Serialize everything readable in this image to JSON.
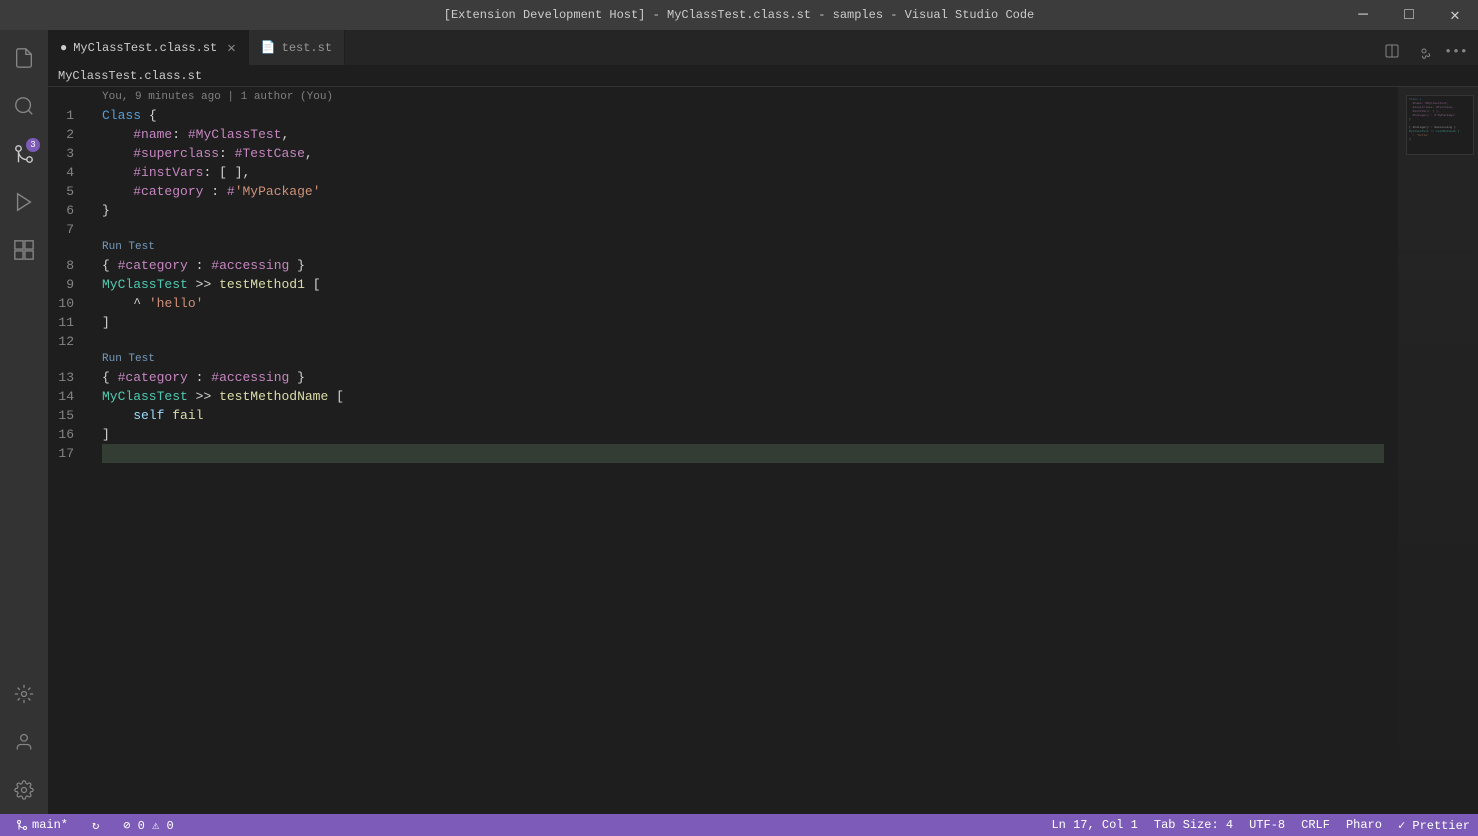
{
  "titlebar": {
    "title": "[Extension Development Host] - MyClassTest.class.st - samples - Visual Studio Code",
    "minimize": "─",
    "maximize": "□",
    "close": "✕"
  },
  "tabs": [
    {
      "id": "tab1",
      "label": "MyClassTest.class.st",
      "active": true,
      "icon": "📄"
    },
    {
      "id": "tab2",
      "label": "test.st",
      "active": false,
      "icon": "📄"
    }
  ],
  "breadcrumb": {
    "path": "MyClassTest.class.st"
  },
  "author_hint": "You, 9 minutes ago | 1 author (You)",
  "code_lines": [
    {
      "num": 1,
      "content": "Class {",
      "type": "normal"
    },
    {
      "num": 2,
      "content": "    #name: #MyClassTest,",
      "type": "normal"
    },
    {
      "num": 3,
      "content": "    #superclass: #TestCase,",
      "type": "normal"
    },
    {
      "num": 4,
      "content": "    #instVars: [ ],",
      "type": "normal"
    },
    {
      "num": 5,
      "content": "    #category : #'MyPackage'",
      "type": "normal"
    },
    {
      "num": 6,
      "content": "}",
      "type": "normal"
    },
    {
      "num": 7,
      "content": "",
      "type": "normal"
    },
    {
      "num": 8,
      "content": "{ #category : #accessing }",
      "type": "normal"
    },
    {
      "num": 9,
      "content": "MyClassTest >> testMethod1 [",
      "type": "normal"
    },
    {
      "num": 10,
      "content": "    ^ 'hello'",
      "type": "normal"
    },
    {
      "num": 11,
      "content": "]",
      "type": "normal"
    },
    {
      "num": 12,
      "content": "",
      "type": "normal"
    },
    {
      "num": 13,
      "content": "{ #category : #accessing }",
      "type": "normal"
    },
    {
      "num": 14,
      "content": "MyClassTest >> testMethodName [",
      "type": "normal"
    },
    {
      "num": 15,
      "content": "    self fail",
      "type": "normal"
    },
    {
      "num": 16,
      "content": "]",
      "type": "normal"
    },
    {
      "num": 17,
      "content": "",
      "type": "current"
    }
  ],
  "run_test_1": "Run Test",
  "run_test_2": "Run Test",
  "status_bar": {
    "branch": "main*",
    "sync": "↻",
    "errors": "⊘ 0",
    "warnings": "⚠ 0",
    "position": "Ln 17, Col 1",
    "tab_size": "Tab Size: 4",
    "encoding": "UTF-8",
    "line_ending": "CRLF",
    "language": "Pharo",
    "formatter": "✓ Prettier"
  },
  "activity_icons": [
    {
      "id": "files",
      "icon": "⎘",
      "active": false
    },
    {
      "id": "search",
      "icon": "🔍",
      "active": false
    },
    {
      "id": "source-control",
      "icon": "⎇",
      "active": false,
      "badge": "3"
    },
    {
      "id": "debug",
      "icon": "▷",
      "active": false
    },
    {
      "id": "extensions",
      "icon": "⊞",
      "active": false
    }
  ],
  "activity_bottom": [
    {
      "id": "remote",
      "icon": "⌂"
    },
    {
      "id": "account",
      "icon": "👤"
    },
    {
      "id": "settings",
      "icon": "⚙"
    }
  ]
}
